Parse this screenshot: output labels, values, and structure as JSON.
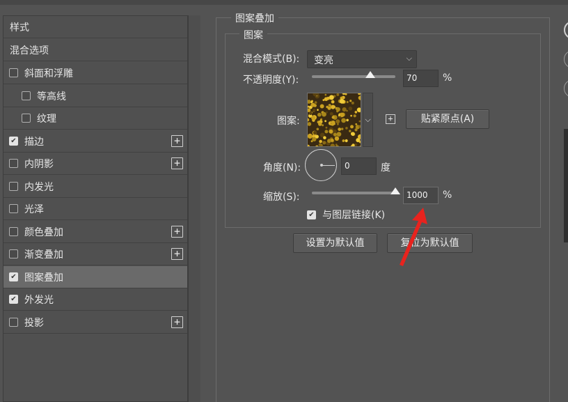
{
  "styles_list": {
    "header_label": "样式",
    "blend_options_label": "混合选项",
    "items": [
      {
        "label": "斜面和浮雕",
        "checked": false,
        "indent": false,
        "has_add": false
      },
      {
        "label": "等高线",
        "checked": false,
        "indent": true,
        "has_add": false
      },
      {
        "label": "纹理",
        "checked": false,
        "indent": true,
        "has_add": false
      },
      {
        "label": "描边",
        "checked": true,
        "indent": false,
        "has_add": true
      },
      {
        "label": "内阴影",
        "checked": false,
        "indent": false,
        "has_add": true
      },
      {
        "label": "内发光",
        "checked": false,
        "indent": false,
        "has_add": false
      },
      {
        "label": "光泽",
        "checked": false,
        "indent": false,
        "has_add": false
      },
      {
        "label": "颜色叠加",
        "checked": false,
        "indent": false,
        "has_add": true
      },
      {
        "label": "渐变叠加",
        "checked": false,
        "indent": false,
        "has_add": true
      },
      {
        "label": "图案叠加",
        "checked": true,
        "indent": false,
        "has_add": false,
        "selected": true
      },
      {
        "label": "外发光",
        "checked": true,
        "indent": false,
        "has_add": false
      },
      {
        "label": "投影",
        "checked": false,
        "indent": false,
        "has_add": true
      }
    ]
  },
  "panel": {
    "section_title": "图案叠加",
    "group_title": "图案",
    "blend_mode_label": "混合模式(B):",
    "blend_mode_value": "变亮",
    "opacity_label": "不透明度(Y):",
    "opacity_value": "70",
    "opacity_fraction": 0.7,
    "percent_sign": "%",
    "pattern_label": "图案:",
    "snap_origin_button": "贴紧原点(A)",
    "angle_label": "角度(N):",
    "angle_value": "0",
    "degree_unit": "度",
    "scale_label": "缩放(S):",
    "scale_value": "1000",
    "scale_fraction": 1.0,
    "link_label": "与图层链接(K)",
    "link_checked": true,
    "set_default_button": "设置为默认值",
    "reset_default_button": "复位为默认值"
  },
  "colors": {
    "background": "#535353",
    "selected_row": "#6a6a6a",
    "annotation_arrow": "#e8231e"
  }
}
